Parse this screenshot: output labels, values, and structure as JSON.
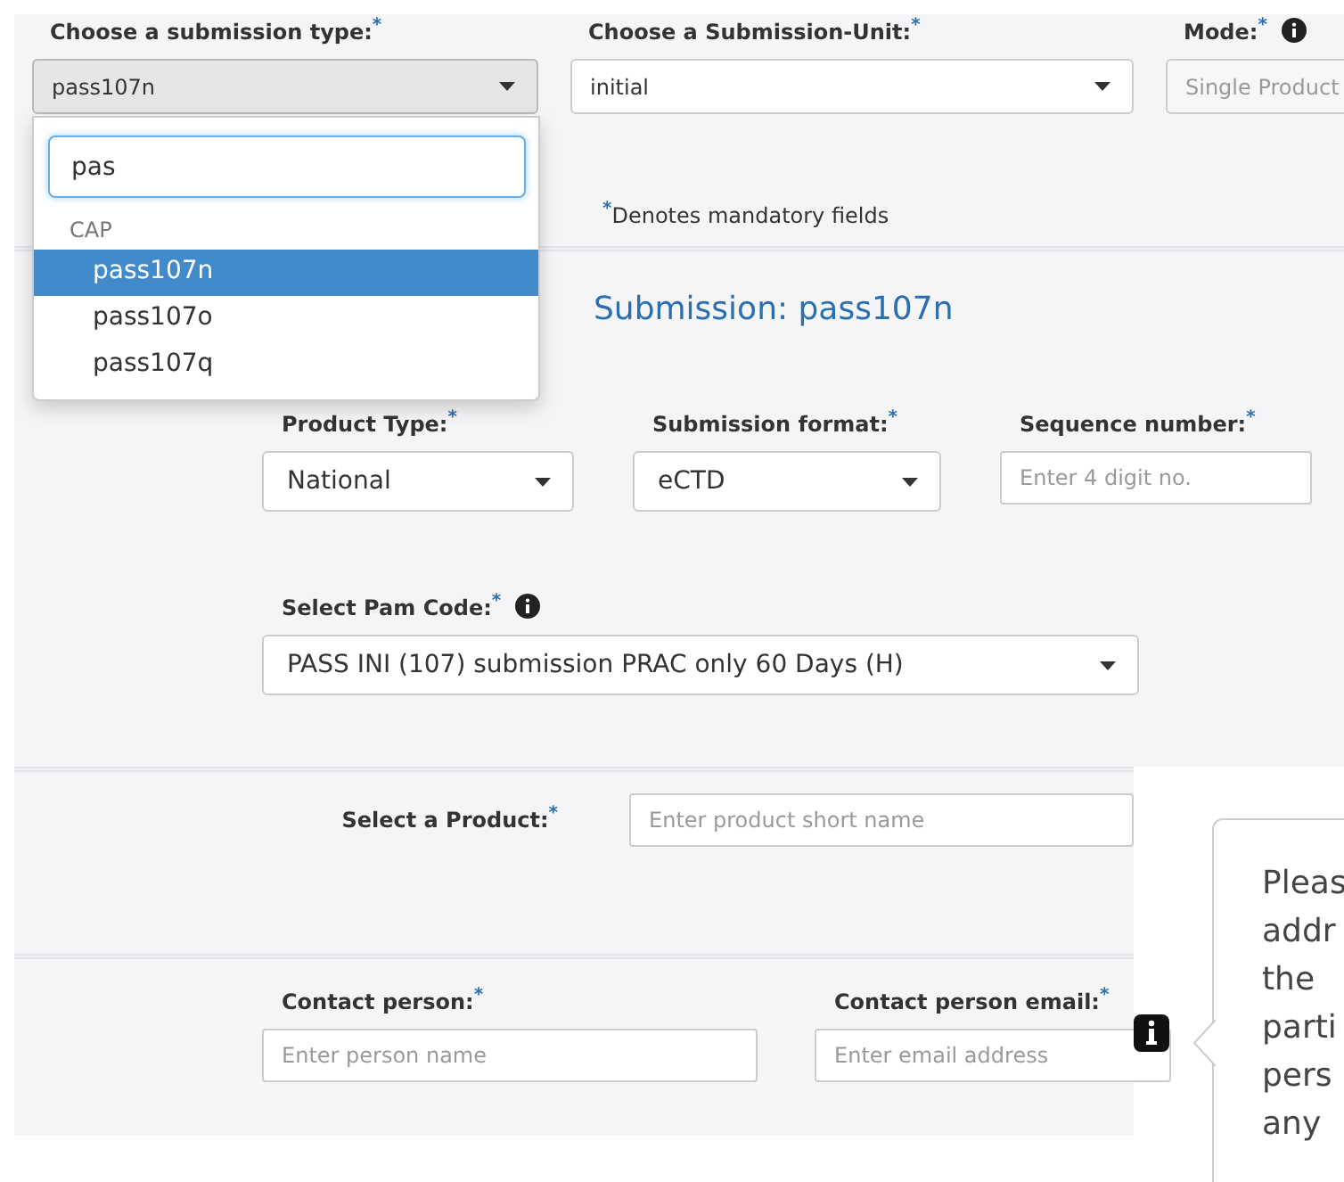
{
  "top_fields": [
    {
      "kind": "select",
      "label": "Choose a submission type:",
      "asterisk": "*",
      "value": "pass107n",
      "open": true
    },
    {
      "kind": "select",
      "label": "Choose a Submission-Unit:",
      "asterisk": "*",
      "value": "initial",
      "open": false
    },
    {
      "kind": "disabled",
      "label": "Mode:",
      "asterisk": "*",
      "info": true,
      "placeholder": "Single Product"
    }
  ],
  "dropdown": {
    "search": "pas",
    "group": "CAP",
    "options": [
      {
        "label": "pass107n",
        "selected": true
      },
      {
        "label": "pass107o",
        "selected": false
      },
      {
        "label": "pass107q",
        "selected": false
      }
    ]
  },
  "mandatory_note": {
    "asterisk": "*",
    "text": "Denotes mandatory fields"
  },
  "submission_title": "Submission: pass107n",
  "detail_fields": [
    {
      "kind": "select",
      "label": "Product Type:",
      "asterisk": "*",
      "value": "National"
    },
    {
      "kind": "select",
      "label": "Submission format:",
      "asterisk": "*",
      "value": "eCTD"
    },
    {
      "kind": "input",
      "label": "Sequence number:",
      "asterisk": "*",
      "placeholder": "Enter 4 digit no."
    }
  ],
  "pam_code": {
    "label": "Select Pam Code:",
    "asterisk": "*",
    "info": true,
    "value": "PASS INI (107) submission PRAC only 60 Days (H)"
  },
  "product": {
    "label": "Select a Product:",
    "asterisk": "*",
    "placeholder": "Enter product short name"
  },
  "contact_fields": [
    {
      "label": "Contact person:",
      "asterisk": "*",
      "placeholder": "Enter person name",
      "info": false
    },
    {
      "label": "Contact person email:",
      "asterisk": "*",
      "placeholder": "Enter email address",
      "info": true
    }
  ],
  "popover": {
    "lines": [
      "Pleas",
      "addr",
      "the",
      "parti",
      "pers",
      "any"
    ]
  }
}
